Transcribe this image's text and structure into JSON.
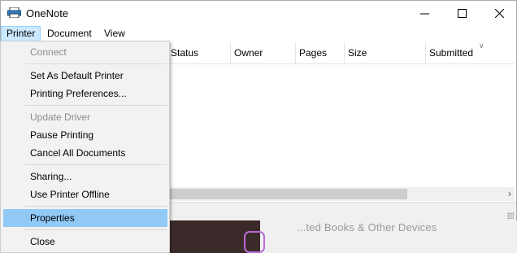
{
  "window": {
    "title": "OneNote"
  },
  "menubar": [
    "Printer",
    "Document",
    "View"
  ],
  "columns": [
    "Status",
    "Owner",
    "Pages",
    "Size",
    "Submitted"
  ],
  "dropdown": {
    "connect": "Connect",
    "set_default": "Set As Default Printer",
    "printing_prefs": "Printing Preferences...",
    "update_driver": "Update Driver",
    "pause": "Pause Printing",
    "cancel_all": "Cancel All Documents",
    "sharing": "Sharing...",
    "offline": "Use Printer Offline",
    "properties": "Properties",
    "close": "Close"
  },
  "background_text": "...ted Books & Other Devices",
  "colors": {
    "hover": "#91c9f7",
    "menu_active": "#cce8ff",
    "disabled": "#8c8c8c"
  },
  "icons": [
    "printer-icon",
    "minimize-icon",
    "maximize-icon",
    "close-icon",
    "sort-chevron-icon",
    "scroll-right-arrow-icon",
    "resize-grip-icon"
  ]
}
